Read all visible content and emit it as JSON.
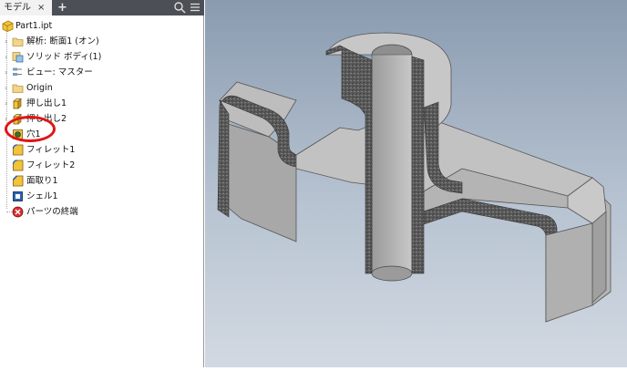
{
  "tabs": {
    "model_label": "モデル",
    "close_glyph": "×",
    "add_glyph": "+"
  },
  "toolbar": {
    "search_icon": "search-icon",
    "menu_icon": "menu-icon"
  },
  "tree": {
    "root": "Part1.ipt",
    "items": [
      {
        "label": "解析: 断面1 (オン)",
        "icon": "folder-icon"
      },
      {
        "label": "ソリッド ボディ(1)",
        "icon": "solid-body-icon"
      },
      {
        "label": "ビュー: マスター",
        "icon": "view-icon"
      },
      {
        "label": "Origin",
        "icon": "folder-icon"
      },
      {
        "label": "押し出し1",
        "icon": "extrude-icon"
      },
      {
        "label": "押し出し2",
        "icon": "extrude-icon"
      },
      {
        "label": "穴1",
        "icon": "hole-icon",
        "highlighted": true
      },
      {
        "label": "フィレット1",
        "icon": "fillet-icon"
      },
      {
        "label": "フィレット2",
        "icon": "fillet-icon"
      },
      {
        "label": "面取り1",
        "icon": "chamfer-icon"
      },
      {
        "label": "シェル1",
        "icon": "shell-icon"
      },
      {
        "label": "パーツの終端",
        "icon": "end-of-part-icon"
      }
    ]
  },
  "colors": {
    "highlight_ring": "#e01515",
    "tabbar": "#4c4f55",
    "viewport_top": "#8a9bb0",
    "viewport_bottom": "#d2d9e2"
  }
}
